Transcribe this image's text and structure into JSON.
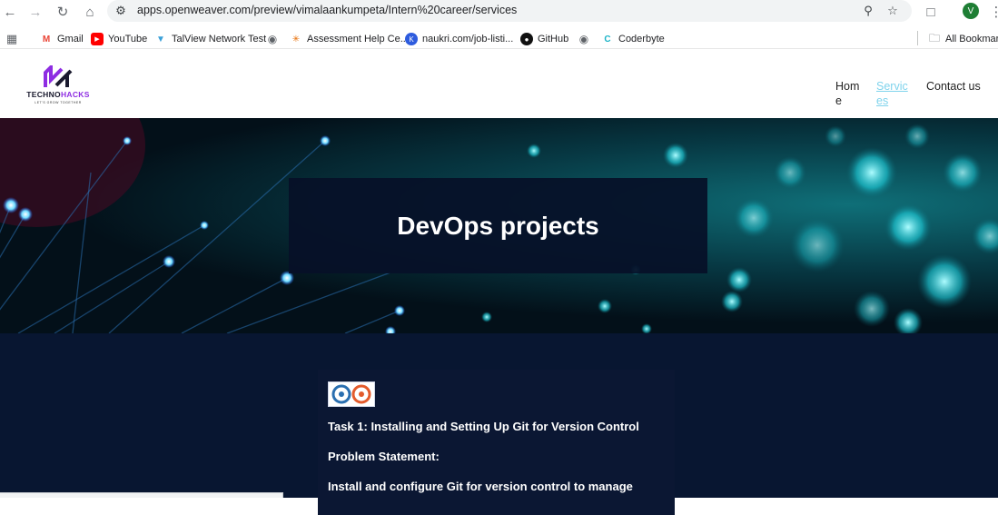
{
  "browser": {
    "url": "apps.openweaver.com/preview/vimalaankumpeta/Intern%20career/services",
    "profile_initial": "V",
    "bookmarks": [
      {
        "label": "Gmail",
        "icon": "gmail-icon"
      },
      {
        "label": "YouTube",
        "icon": "youtube-icon"
      },
      {
        "label": "TalView Network Test",
        "icon": "talview-icon"
      },
      {
        "label": "",
        "icon": "globe-icon"
      },
      {
        "label": "Assessment Help Ce...",
        "icon": "assessment-icon"
      },
      {
        "label": "naukri.com/job-listi...",
        "icon": "naukri-icon"
      },
      {
        "label": "GitHub",
        "icon": "github-icon"
      },
      {
        "label": "",
        "icon": "globe-icon"
      },
      {
        "label": "Coderbyte",
        "icon": "coderbyte-icon"
      }
    ],
    "all_bookmarks": "All Bookmarks"
  },
  "site": {
    "logo": {
      "word1": "TECHNO",
      "word2": "HACKS",
      "tagline": "LET'S GROW TOGETHER"
    },
    "nav": [
      {
        "label": "Home",
        "active": false
      },
      {
        "label": "Services",
        "active": true
      },
      {
        "label": "Contact us",
        "active": false
      }
    ]
  },
  "hero": {
    "title": "DevOps projects"
  },
  "task": {
    "title": "Task 1: Installing and Setting Up Git for Version Control",
    "problem_label": "Problem Statement:",
    "problem_text": "Install and configure Git for version control to manage"
  },
  "colors": {
    "nav_active": "#7fd3ec",
    "content_bg": "#081631",
    "hero_box": "#061028",
    "accent_purple": "#8e2de2"
  }
}
